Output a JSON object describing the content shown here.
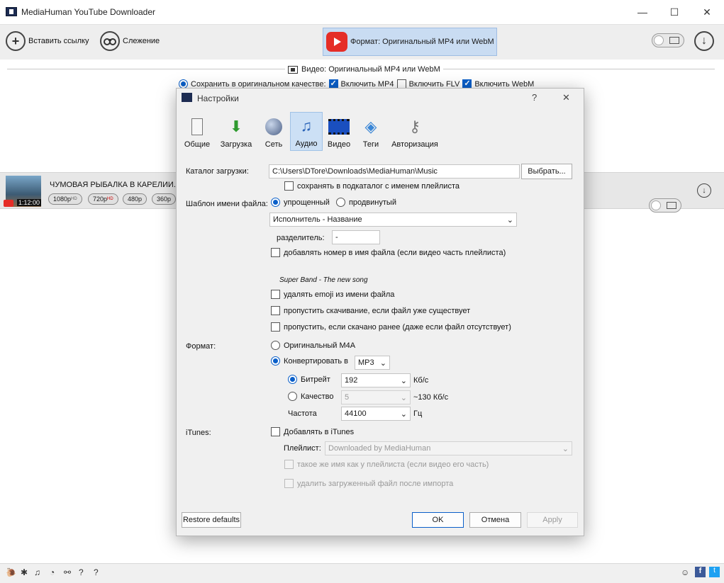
{
  "window": {
    "title": "MediaHuman YouTube Downloader",
    "minimize": "—",
    "maximize": "☐",
    "close": "✕"
  },
  "toolbar": {
    "paste_link": "Вставить ссылку",
    "tracking": "Слежение",
    "format": "Формат: Оригинальный MP4 или WebM"
  },
  "format_panel": {
    "video_label": "Видео: Оригинальный MP4 или WebM",
    "save_original": "Сохранить в оригинальном качестве:",
    "include_mp4": "Включить MP4",
    "include_flv": "Включить FLV",
    "include_webm": "Включить WebM"
  },
  "video_item": {
    "title": "ЧУМОВАЯ РЫБАЛКА В КАРЕЛИИ. РЫ",
    "duration": "1:12:00",
    "qualities": [
      "1080p",
      "720p",
      "480p",
      "360p"
    ],
    "badges": [
      "HD",
      "HD"
    ]
  },
  "dialog": {
    "title": "Настройки",
    "help": "?",
    "close": "✕",
    "tabs": [
      {
        "label": "Общие",
        "icon": "switch-icon"
      },
      {
        "label": "Загрузка",
        "icon": "download-arrow-icon"
      },
      {
        "label": "Сеть",
        "icon": "globe-icon"
      },
      {
        "label": "Аудио",
        "icon": "music-note-icon"
      },
      {
        "label": "Видео",
        "icon": "film-icon"
      },
      {
        "label": "Теги",
        "icon": "tag-icon"
      },
      {
        "label": "Авторизация",
        "icon": "keys-icon"
      }
    ],
    "active_tab": "Аудио",
    "download_dir_label": "Каталог загрузки:",
    "download_dir_value": "C:\\Users\\DTore\\Downloads\\MediaHuman\\Music",
    "browse": "Выбрать...",
    "save_subdir": "сохранять в подкаталог с именем плейлиста",
    "filename_template_label": "Шаблон имени файла:",
    "simple": "упрощенный",
    "advanced": "продвинутый",
    "template_value": "Исполнитель - Название",
    "separator_label": "разделитель:",
    "separator_value": "-",
    "add_number": "добавлять номер в имя файла (если видео часть плейлиста)",
    "example": "Super Band - The new song",
    "remove_emoji": "удалять emoji из имени файла",
    "skip_existing": "пропустить скачивание, если файл уже существует",
    "skip_downloaded": "пропустить, если скачано ранее (даже если файл отсутствует)",
    "format_label": "Формат:",
    "original_m4a": "Оригинальный M4A",
    "convert_to": "Конвертировать в",
    "convert_format": "MP3",
    "bitrate_label": "Битрейт",
    "bitrate_value": "192",
    "bitrate_unit": "Кб/с",
    "quality_label": "Качество",
    "quality_value": "5",
    "quality_hint": "~130 Кб/с",
    "frequency_label": "Частота",
    "frequency_value": "44100",
    "frequency_unit": "Гц",
    "itunes_label": "iTunes:",
    "add_itunes": "Добавлять в iTunes",
    "playlist_label": "Плейлист:",
    "playlist_value": "Downloaded by MediaHuman",
    "same_name": "такое же имя как у плейлиста (если видео его часть)",
    "delete_after": "удалить загруженный файл после импорта",
    "restore": "Restore defaults",
    "ok": "OK",
    "cancel": "Отмена",
    "apply": "Apply"
  },
  "bottom_icons": [
    "snail-icon",
    "gear-icon",
    "music-icon",
    "clock-icon",
    "binoculars-icon",
    "help-icon",
    "social-share-icon",
    "facebook-icon",
    "twitter-icon"
  ]
}
